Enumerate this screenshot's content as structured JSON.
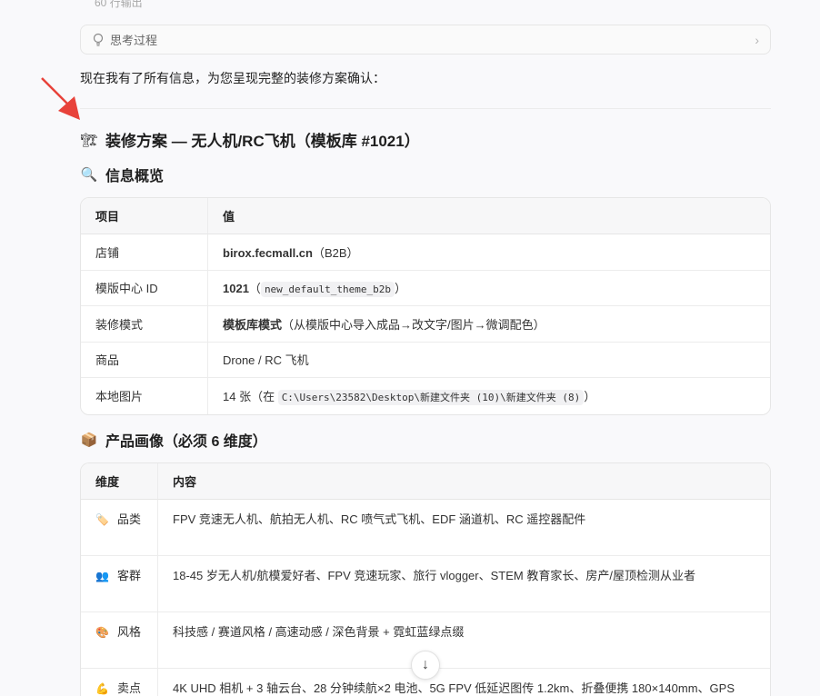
{
  "clip_text": "60 行输出",
  "thinking": {
    "label": "思考过程"
  },
  "intro": "现在我有了所有信息，为您呈现完整的装修方案确认：",
  "title": {
    "icon": "🏗",
    "text": "装修方案 — 无人机/RC飞机（模板库 #1021）"
  },
  "section1": {
    "icon": "🔍",
    "title": "信息概览"
  },
  "info_table": {
    "headers": [
      "项目",
      "值"
    ],
    "rows": [
      {
        "key": "店铺",
        "bold": "birox.fecmall.cn",
        "rest": "（B2B）"
      },
      {
        "key": "模版中心 ID",
        "bold": "1021",
        "pre": "（",
        "code": "new_default_theme_b2b",
        "post": "）"
      },
      {
        "key": "装修模式",
        "bold": "模板库模式",
        "rest": "（从模版中心导入成品→改文字/图片→微调配色）"
      },
      {
        "key": "商品",
        "rest": "Drone / RC 飞机"
      },
      {
        "key": "本地图片",
        "pre": "14 张（在 ",
        "code": "C:\\Users\\23582\\Desktop\\新建文件夹 (10)\\新建文件夹 (8)",
        "post": "）"
      }
    ]
  },
  "section2": {
    "icon": "📦",
    "title": "产品画像（必须 6 维度）"
  },
  "persona_table": {
    "headers": [
      "维度",
      "内容"
    ],
    "rows": [
      {
        "icon": "🏷️",
        "dim": "品类",
        "content": "FPV 竞速无人机、航拍无人机、RC 喷气式飞机、EDF 涵道机、RC 遥控器配件"
      },
      {
        "icon": "👥",
        "dim": "客群",
        "content": "18-45 岁无人机/航模爱好者、FPV 竞速玩家、旅行 vlogger、STEM 教育家长、房产/屋顶检测从业者"
      },
      {
        "icon": "🎨",
        "dim": "风格",
        "content": "科技感 / 赛道风格 / 高速动感 / 深色背景 + 霓虹蓝绿点缀"
      },
      {
        "icon": "💪",
        "dim": "卖点",
        "content": "4K UHD 相机 + 3 轴云台、28 分钟续航×2 电池、5G FPV 低延迟图传 1.2km、折叠便携 180×140mm、GPS"
      }
    ]
  },
  "scroll_icon": "↓"
}
